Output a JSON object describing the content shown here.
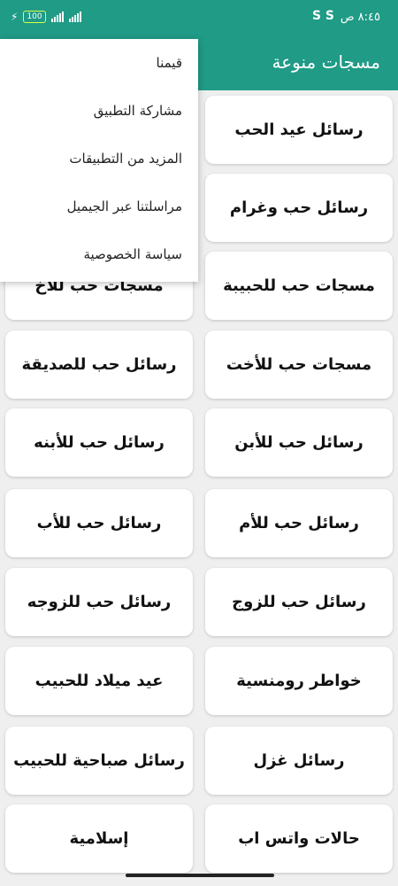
{
  "status": {
    "time": "٨:٤٥ ص",
    "s_icons": "S S",
    "battery": "100",
    "charging_icon": "⚡"
  },
  "appbar": {
    "title": "مسجات منوعة"
  },
  "cards": [
    {
      "label": "رسائل عيد الحب"
    },
    {
      "label": ""
    },
    {
      "label": "رسائل حب وغرام"
    },
    {
      "label": ""
    },
    {
      "label": "مسجات حب للحبيبة"
    },
    {
      "label": "مسجات حب للاخ"
    },
    {
      "label": "مسجات حب للأخت"
    },
    {
      "label": "رسائل حب للصديقة"
    },
    {
      "label": "رسائل حب للأبن"
    },
    {
      "label": "رسائل حب للأبنه"
    },
    {
      "label": "رسائل حب للأم"
    },
    {
      "label": "رسائل حب للأب"
    },
    {
      "label": "رسائل حب للزوج"
    },
    {
      "label": "رسائل حب للزوجه"
    },
    {
      "label": "خواطر رومنسية"
    },
    {
      "label": "عيد ميلاد للحبيب"
    },
    {
      "label": "رسائل غزل"
    },
    {
      "label": "رسائل صباحية للحبيب"
    },
    {
      "label": "حالات واتس اب"
    },
    {
      "label": "إسلامية"
    }
  ],
  "menu": {
    "items": [
      {
        "label": "قيمنا"
      },
      {
        "label": "مشاركة التطبيق"
      },
      {
        "label": "المزيد من التطبيقات"
      },
      {
        "label": "مراسلتنا عبر الجيميل"
      },
      {
        "label": "سياسة الخصوصية"
      }
    ]
  }
}
